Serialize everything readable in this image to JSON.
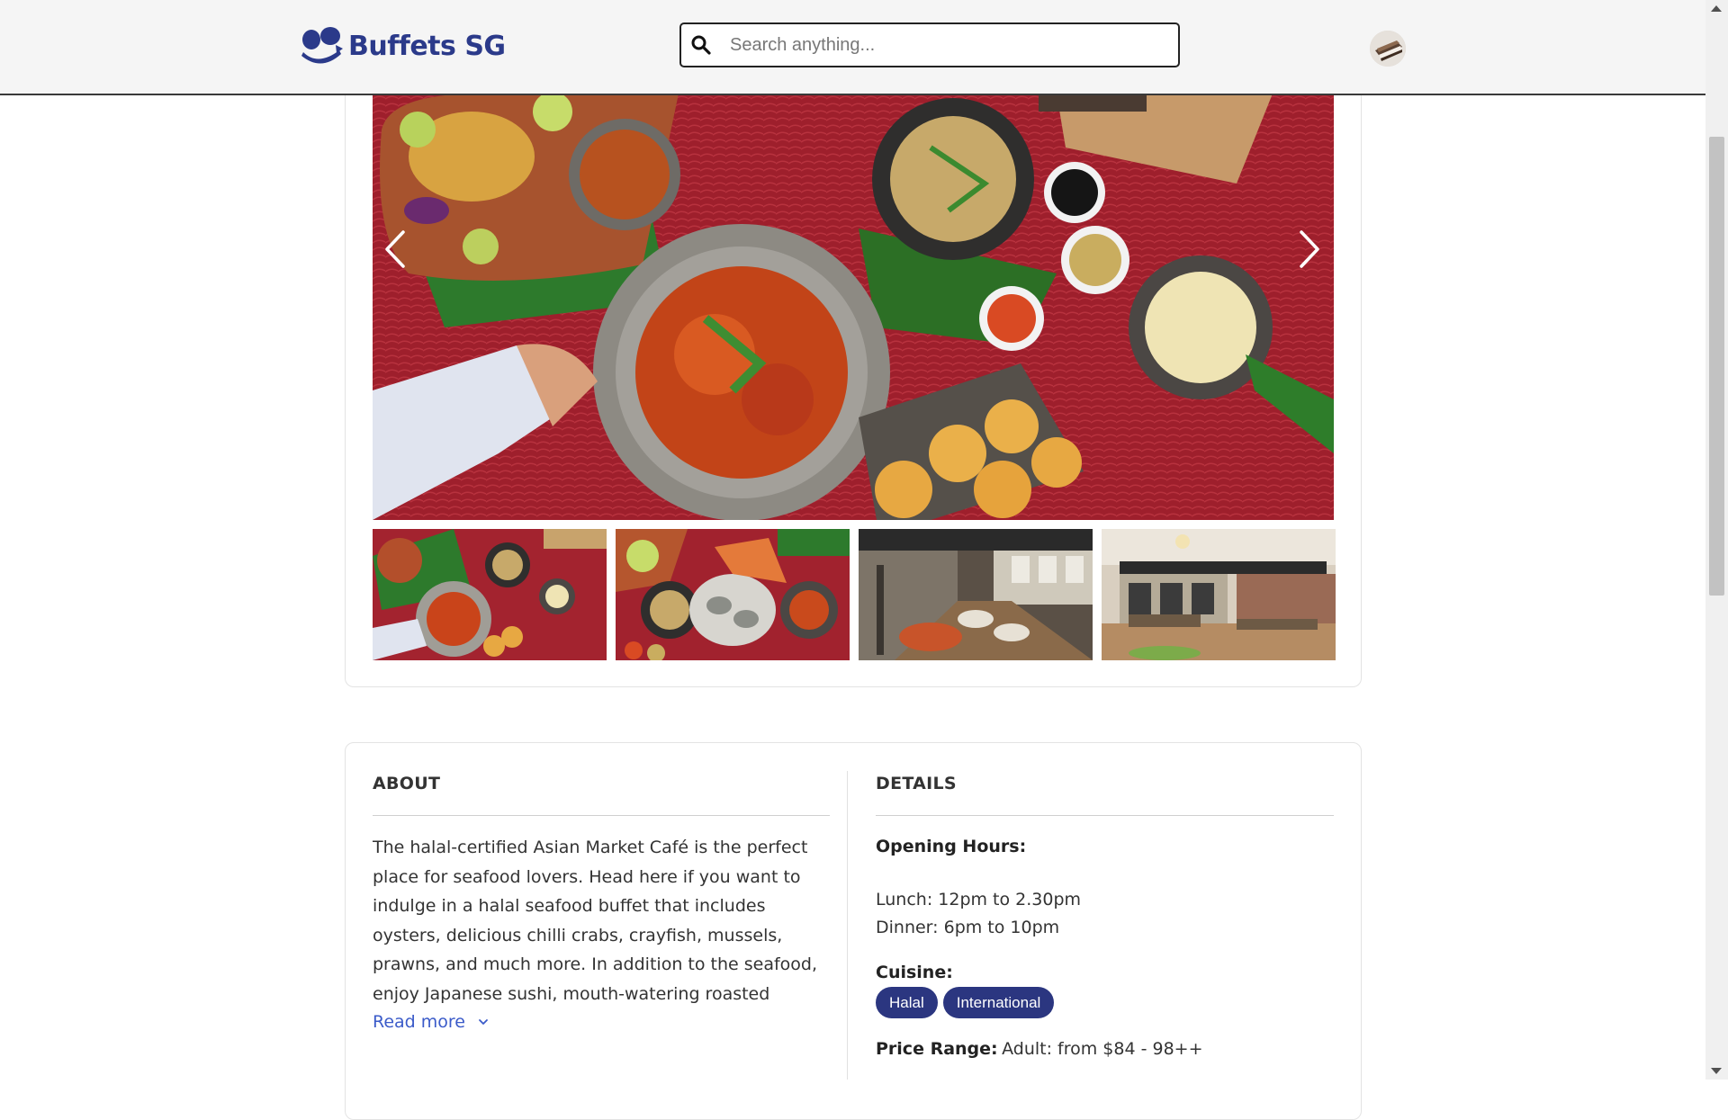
{
  "header": {
    "brand": "Buffets SG",
    "search_placeholder": "Search anything..."
  },
  "gallery": {
    "hero_image": "chilli-crab-spread",
    "thumbnails": [
      "seafood-spread",
      "oyster-platter",
      "buffet-counter",
      "dining-hall"
    ]
  },
  "about": {
    "title": "ABOUT",
    "text": "The halal-certified Asian Market Café is the perfect place for seafood lovers. Head here if you want to indulge in a halal seafood buffet that includes oysters, delicious chilli crabs, crayfish, mussels, prawns, and much more. In addition to the seafood, enjoy Japanese sushi, mouth-watering roasted",
    "read_more": "Read more"
  },
  "details": {
    "title": "DETAILS",
    "opening_hours_label": "Opening Hours:",
    "lunch": "Lunch: 12pm to 2.30pm",
    "dinner": "Dinner: 6pm to 10pm",
    "cuisine_label": "Cuisine:",
    "cuisines": [
      "Halal",
      "International"
    ],
    "price_label": "Price Range:",
    "price_value": "Adult: from $84 - 98++"
  },
  "colors": {
    "brand": "#2b3a8a",
    "tag_bg": "#2b3680",
    "link": "#3b5bc9"
  }
}
